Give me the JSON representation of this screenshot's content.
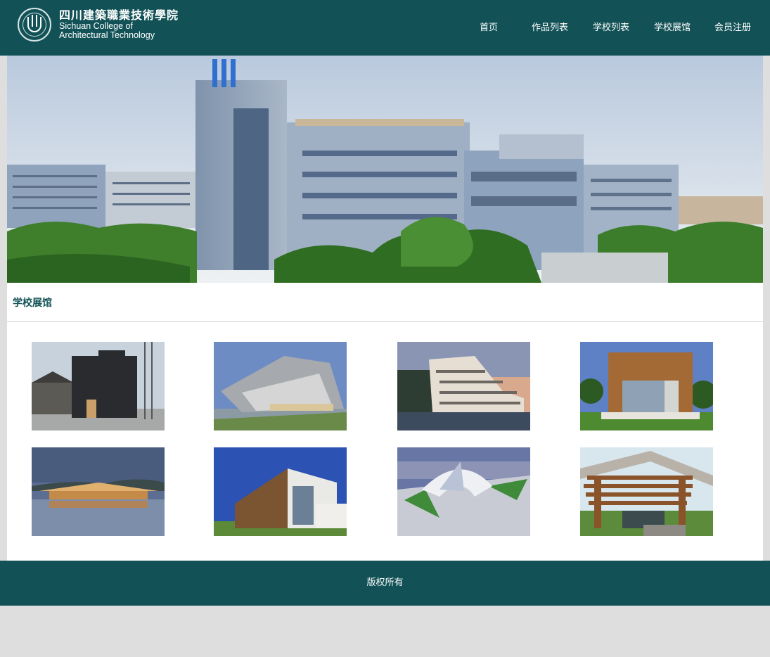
{
  "header": {
    "logo_cn": "四川建築職業技術學院",
    "logo_en_line1": "Sichuan College of",
    "logo_en_line2": "Architectural Technology"
  },
  "nav": {
    "items": [
      {
        "label": "首页"
      },
      {
        "label": "作品列表"
      },
      {
        "label": "学校列表"
      },
      {
        "label": "学校展馆"
      },
      {
        "label": "会员注册"
      }
    ]
  },
  "section": {
    "title": "学校展馆"
  },
  "footer": {
    "copyright": "版权所有"
  },
  "colors": {
    "brand": "#125257",
    "page_bg": "#dedede"
  }
}
